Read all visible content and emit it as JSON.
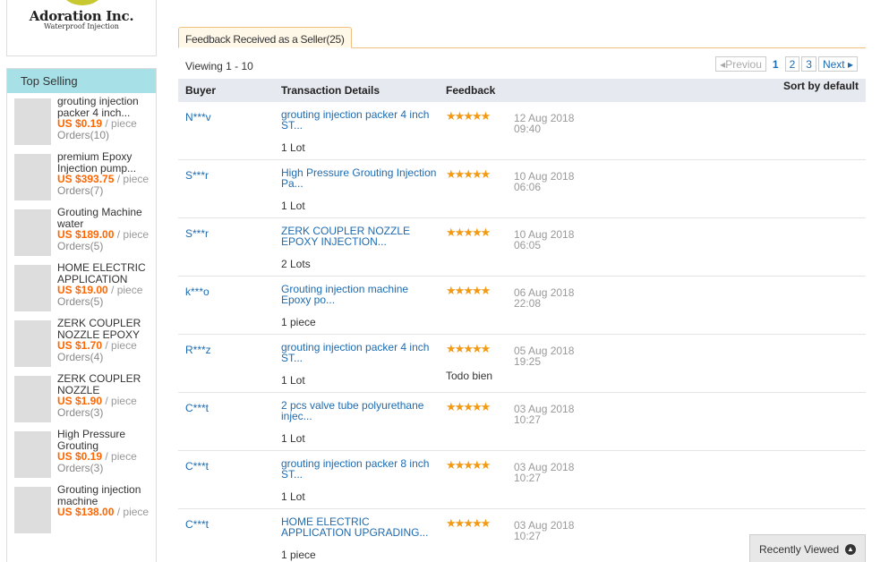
{
  "logo": {
    "title": "Adoration Inc.",
    "subtitle": "Waterproof Injection"
  },
  "sidebar": {
    "header": "Top Selling",
    "products": [
      {
        "name": "grouting injection packer 4 inch...",
        "price": "US $0.19",
        "unit": " / piece",
        "orders": "Orders(10)"
      },
      {
        "name": "premium Epoxy Injection pump...",
        "price": "US $393.75",
        "unit": " / piece",
        "orders": "Orders(7)"
      },
      {
        "name": "Grouting Machine water",
        "price": "US $189.00",
        "unit": " / piece",
        "orders": "Orders(5)"
      },
      {
        "name": "HOME ELECTRIC APPLICATION",
        "price": "US $19.00",
        "unit": " / piece",
        "orders": "Orders(5)"
      },
      {
        "name": "ZERK COUPLER NOZZLE EPOXY",
        "price": "US $1.70",
        "unit": " / piece",
        "orders": "Orders(4)"
      },
      {
        "name": "ZERK COUPLER NOZZLE",
        "price": "US $1.90",
        "unit": " / piece",
        "orders": "Orders(3)"
      },
      {
        "name": "High Pressure Grouting",
        "price": "US $0.19",
        "unit": " / piece",
        "orders": "Orders(3)"
      },
      {
        "name": "Grouting injection machine",
        "price": "US $138.00",
        "unit": " / piece",
        "orders": ""
      }
    ]
  },
  "tab": {
    "label": "Feedback Received as a Seller(25)"
  },
  "viewing": "Viewing 1 - 10",
  "pager": {
    "prev": "Previou",
    "pages": [
      "1",
      "2",
      "3"
    ],
    "next": "Next"
  },
  "table": {
    "headers": {
      "buyer": "Buyer",
      "details": "Transaction Details",
      "feedback": "Feedback",
      "sort": "Sort by default"
    },
    "rows": [
      {
        "buyer": "N***v",
        "title": "grouting injection packer 4 inch ST...",
        "qty": "1 Lot",
        "date": "12 Aug 2018",
        "time": "09:40",
        "comment": ""
      },
      {
        "buyer": "S***r",
        "title": "High Pressure Grouting Injection Pa...",
        "qty": "1 Lot",
        "date": "10 Aug 2018",
        "time": "06:06",
        "comment": ""
      },
      {
        "buyer": "S***r",
        "title": "ZERK COUPLER NOZZLE EPOXY INJECTION...",
        "qty": "2 Lots",
        "date": "10 Aug 2018",
        "time": "06:05",
        "comment": ""
      },
      {
        "buyer": "k***o",
        "title": "Grouting injection machine Epoxy po...",
        "qty": "1 piece",
        "date": "06 Aug 2018",
        "time": "22:08",
        "comment": ""
      },
      {
        "buyer": "R***z",
        "title": "grouting injection packer 4 inch ST...",
        "qty": "1 Lot",
        "date": "05 Aug 2018",
        "time": "19:25",
        "comment": "Todo bien"
      },
      {
        "buyer": "C***t",
        "title": "2 pcs valve tube polyurethane injec...",
        "qty": "1 Lot",
        "date": "03 Aug 2018",
        "time": "10:27",
        "comment": ""
      },
      {
        "buyer": "C***t",
        "title": "grouting injection packer 8 inch ST...",
        "qty": "1 Lot",
        "date": "03 Aug 2018",
        "time": "10:27",
        "comment": ""
      },
      {
        "buyer": "C***t",
        "title": "HOME ELECTRIC APPLICATION UPGRADING...",
        "qty": "1 piece",
        "date": "03 Aug 2018",
        "time": "10:27",
        "comment": ""
      }
    ]
  },
  "recently_viewed": "Recently Viewed",
  "colors": {
    "accent": "#f39a14",
    "link": "#1e6bb0",
    "price": "#ff6600",
    "header_bg": "#a7e1e7"
  }
}
